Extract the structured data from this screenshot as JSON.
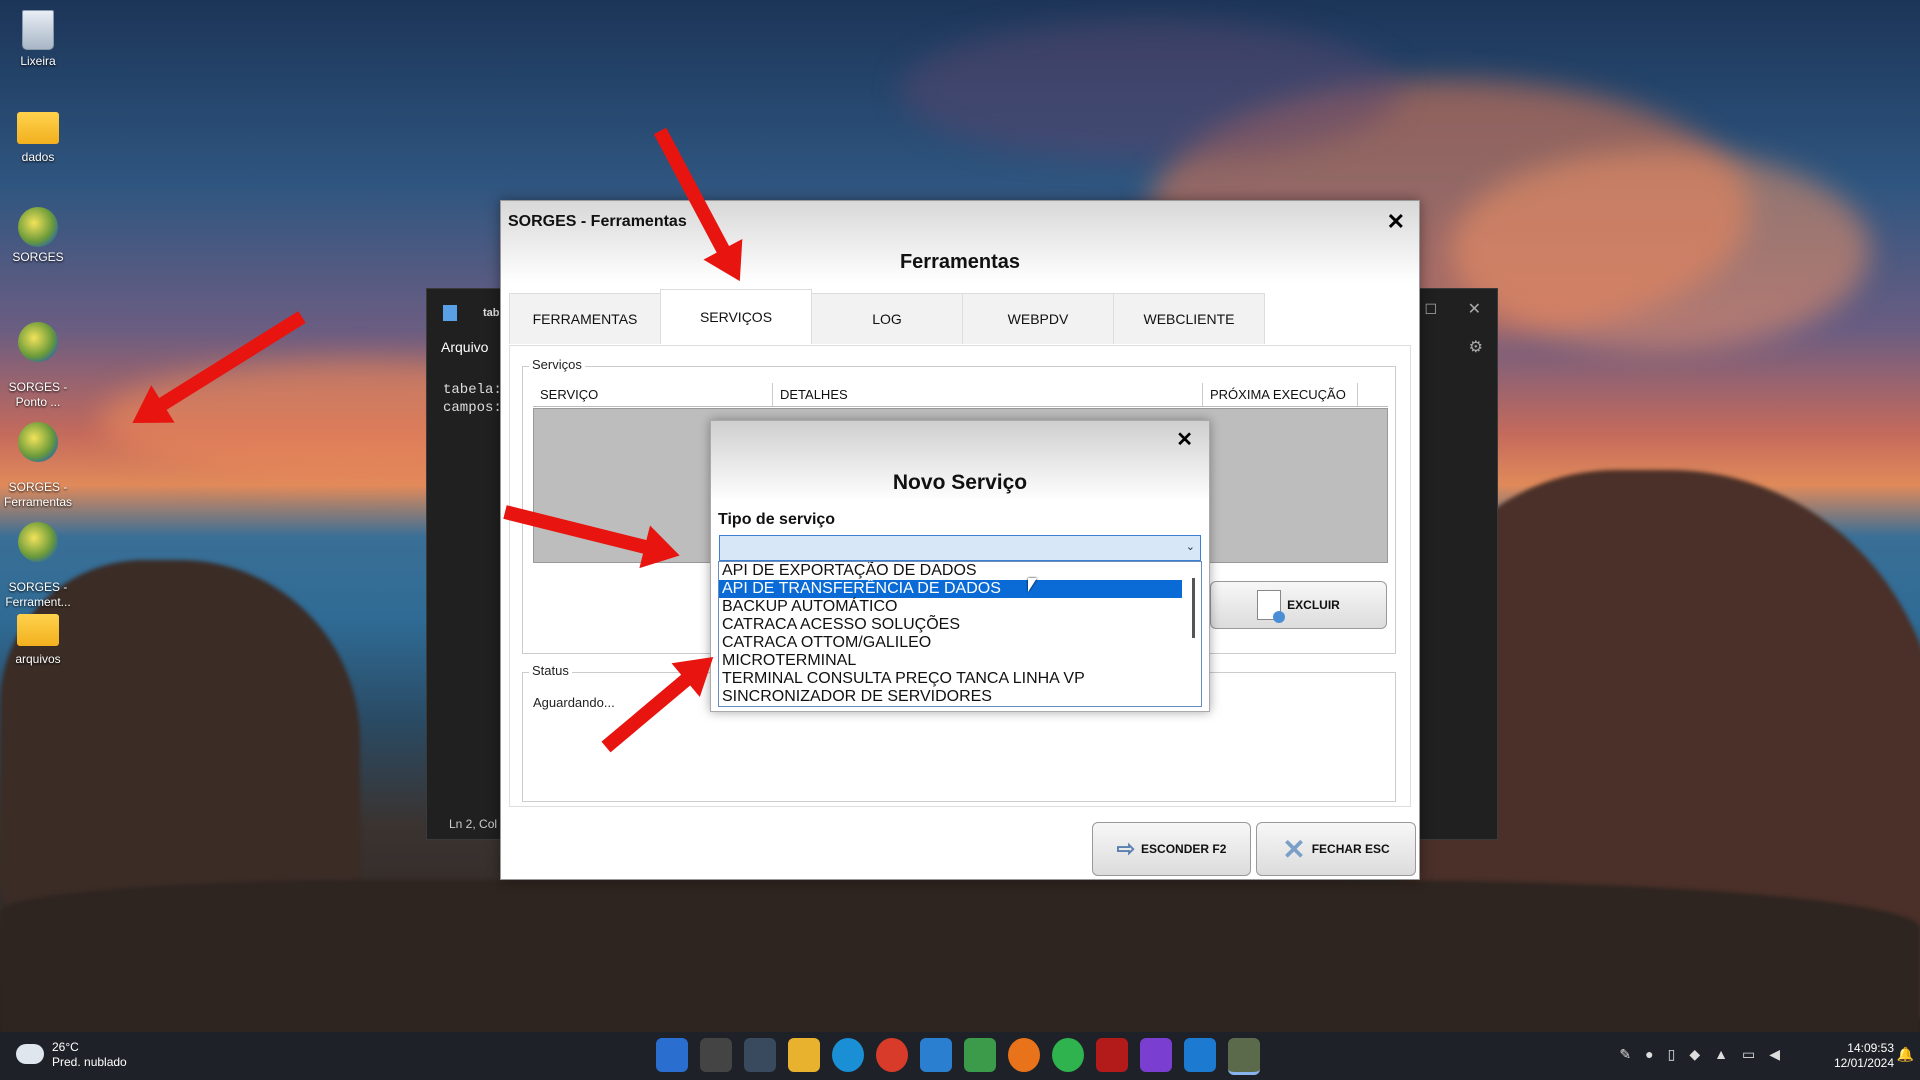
{
  "desktop": {
    "icons": [
      "Lixeira",
      "dados",
      "SORGES",
      "SORGES -\nPonto ...",
      "SORGES -\nFerramentas",
      "SORGES -\nFerrament...",
      "arquivos"
    ]
  },
  "notepad": {
    "tab_label": "tab",
    "menu_label": "Arquivo",
    "lines": [
      "tabela:",
      "campos:"
    ],
    "status": "Ln 2, Col :"
  },
  "main_dialog": {
    "title": "SORGES - Ferramentas",
    "heading": "Ferramentas",
    "close": "✕",
    "tabs": [
      "FERRAMENTAS",
      "SERVIÇOS",
      "LOG",
      "WEBPDV",
      "WEBCLIENTE"
    ],
    "active_tab": "SERVIÇOS",
    "services_group": "Serviços",
    "columns": [
      "SERVIÇO",
      "DETALHES",
      "PRÓXIMA EXECUÇÃO"
    ],
    "excluir_label": "EXCLUIR",
    "status_group": "Status",
    "status_text": "Aguardando...",
    "esconder_label": "ESCONDER F2",
    "fechar_label": "FECHAR ESC"
  },
  "novo_servico": {
    "heading": "Novo Serviço",
    "close": "✕",
    "label": "Tipo de serviço",
    "options": [
      "API DE EXPORTAÇÃO DE DADOS",
      "API DE TRANSFERÊNCIA DE DADOS",
      "BACKUP AUTOMÁTICO",
      "CATRACA ACESSO SOLUÇÕES",
      "CATRACA OTTOM/GALILEO",
      "MICROTERMINAL",
      "TERMINAL CONSULTA PREÇO TANCA LINHA VP",
      "SINCRONIZADOR DE SERVIDORES"
    ],
    "highlighted": "API DE TRANSFERÊNCIA DE DADOS"
  },
  "taskbar": {
    "temp": "26°C",
    "weather": "Pred. nublado",
    "time": "14:09:53",
    "date": "12/01/2024"
  }
}
